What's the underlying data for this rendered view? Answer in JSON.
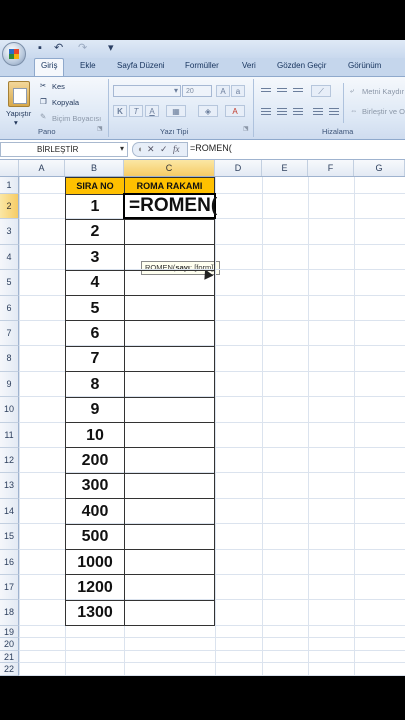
{
  "ribbon": {
    "tabs": [
      "Giriş",
      "Ekle",
      "Sayfa Düzeni",
      "Formüller",
      "Veri",
      "Gözden Geçir",
      "Görünüm"
    ],
    "clipboard": {
      "paste_label": "Yapıştır",
      "cut_label": "Kes",
      "copy_label": "Kopyala",
      "format_painter_label": "Biçim Boyacısı",
      "group_label": "Pano"
    },
    "font": {
      "size_value": "20",
      "bold": "K",
      "italic": "T",
      "underline": "A",
      "group_label": "Yazı Tipi"
    },
    "alignment": {
      "wrap_text_label": "Metni Kaydır",
      "merge_label": "Birleştir ve O",
      "group_label": "Hizalama"
    }
  },
  "formula_bar": {
    "name_box_value": "BİRLEŞTİR",
    "cancel_symbol": "✕",
    "enter_symbol": "✓",
    "fx_symbol": "fx",
    "formula_text": "=ROMEN("
  },
  "sheet": {
    "columns": [
      "A",
      "B",
      "C",
      "D",
      "E",
      "F",
      "G"
    ],
    "rows": [
      "1",
      "2",
      "3",
      "4",
      "5",
      "6",
      "7",
      "8",
      "9",
      "10",
      "11",
      "12",
      "13",
      "14",
      "15",
      "16",
      "17",
      "18",
      "19",
      "20",
      "21",
      "22"
    ],
    "header_b": "SIRA NO",
    "header_c": "ROMA RAKAMI",
    "numbers": [
      "1",
      "2",
      "3",
      "4",
      "5",
      "6",
      "7",
      "8",
      "9",
      "10",
      "200",
      "300",
      "400",
      "500",
      "1000",
      "1200",
      "1300"
    ],
    "active_cell_text": "=ROMEN(",
    "tooltip_func": "ROMEN(",
    "tooltip_arg_bold": "sayı",
    "tooltip_arg_rest": "; [form])",
    "header_fill": "#ffc000"
  }
}
